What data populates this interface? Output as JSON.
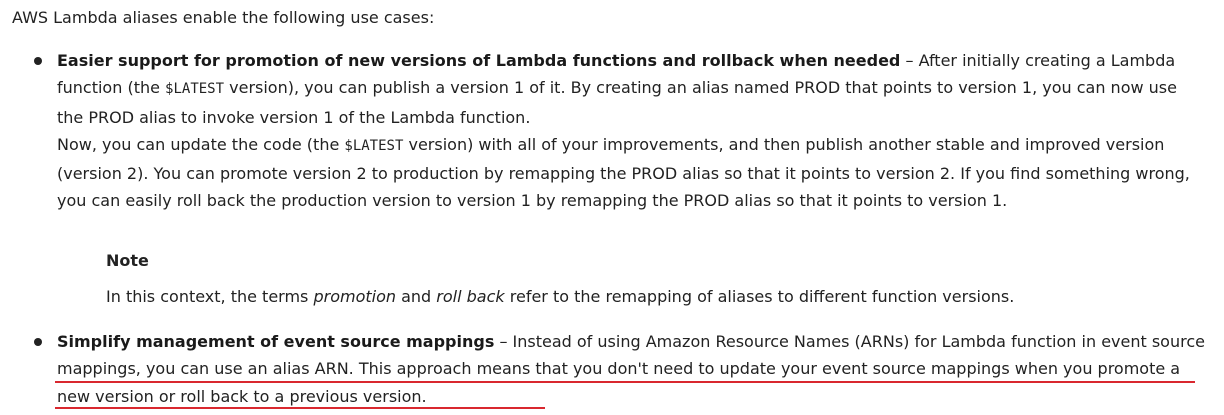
{
  "intro": "AWS Lambda aliases enable the following use cases:",
  "item1": {
    "heading": "Easier support for promotion of new versions of Lambda functions and rollback when needed",
    "dash": " – ",
    "p1_a": "After initially creating a Lambda function (the ",
    "latest_1": "$LATEST",
    "p1_b": " version), you can publish a version 1 of it. By creating an alias named PROD that points to version 1, you can now use the PROD alias to invoke version 1 of the Lambda function.",
    "p2_a": "Now, you can update the code (the ",
    "latest_2": "$LATEST",
    "p2_b": " version) with all of your improvements, and then publish another stable and improved version (version 2). You can promote version 2 to production by remapping the PROD alias so that it points to version 2. If you find something wrong, you can easily roll back the production version to version 1 by remapping the PROD alias so that it points to version 1."
  },
  "note": {
    "title": "Note",
    "text_a": "In this context, the terms ",
    "em1": "promotion",
    "text_b": " and ",
    "em2": "roll back",
    "text_c": " refer to the remapping of aliases to different function versions."
  },
  "item2": {
    "heading": "Simplify management of event source mappings",
    "dash": " – ",
    "text": "Instead of using Amazon Resource Names (ARNs) for Lambda function in event source mappings, you can use an alias ARN. This approach means that you don't need to update your event source mappings when you promote a new version or roll back to a previous version."
  },
  "highlight_color": "#d9282f"
}
